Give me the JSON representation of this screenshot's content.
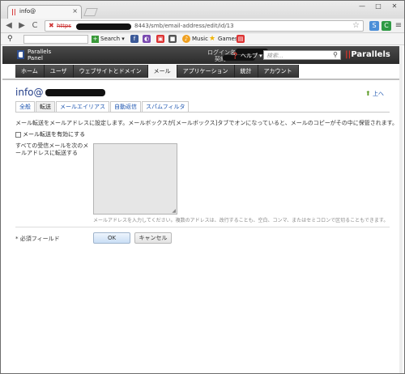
{
  "browser": {
    "tab_title": "info@",
    "tab_close": "×",
    "window_controls": [
      "—",
      "□",
      "✕"
    ],
    "url_scheme": "https",
    "url_path": "8443/smb/email-address/edit/id/13",
    "nav": {
      "back": "◀",
      "forward": "▶",
      "reload": "C"
    }
  },
  "bookmarks": {
    "search_label": "Search",
    "items": [
      "Music",
      "Games"
    ]
  },
  "plesk": {
    "logo_line1": "Parallels",
    "logo_line2": "Panel",
    "login_label": "ログイン名",
    "login_sub": "契約",
    "help_label": "ヘルプ",
    "search_placeholder": "検索...",
    "brand": "Parallels",
    "nav_tabs": [
      "ホーム",
      "ユーザ",
      "ウェブサイトとドメイン",
      "メール",
      "アプリケーション",
      "統計",
      "アカウント"
    ],
    "active_nav": "メール"
  },
  "page": {
    "title_prefix": "info@",
    "up_link": "上へ",
    "subtabs": [
      "全般",
      "転送",
      "メールエイリアス",
      "自動返信",
      "スパムフィルタ"
    ],
    "active_subtab": "転送",
    "description": "メール転送をメールアドレスに設定します。メールボックスが[メールボックス]タブでオンになっていると、メールのコピーがその中に保管されます。",
    "enable_forwarding": "メール転送を有効にする",
    "forward_label": "すべての受信メールを次のメールアドレスに転送する",
    "hint": "メールアドレスを入力してください。複数のアドレスは、改行することも、空白、コンマ、またはセミコロンで区切ることもできます。",
    "required_label": "* 必須フィールド",
    "ok_label": "OK",
    "cancel_label": "キャンセル"
  }
}
